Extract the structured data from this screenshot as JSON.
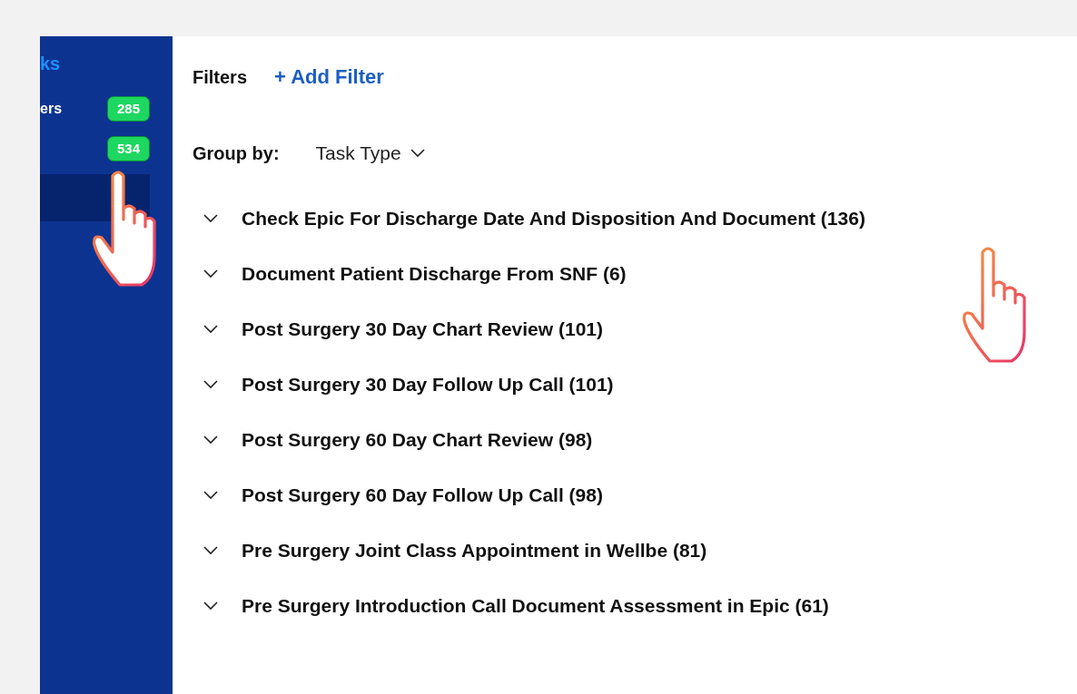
{
  "sidebar": {
    "title": "ks",
    "items": [
      {
        "label": "ers",
        "badge": "285",
        "selected": false
      },
      {
        "badge": "534",
        "selected": false
      },
      {
        "selected": true
      }
    ]
  },
  "filters": {
    "label": "Filters",
    "add_link": "+ Add Filter"
  },
  "group_by": {
    "label": "Group by:",
    "value": "Task Type"
  },
  "groups": [
    {
      "title": "Check Epic For Discharge Date And Disposition And Document (136)",
      "expanded": false
    },
    {
      "title": "Document Patient Discharge From SNF (6)",
      "expanded": false
    },
    {
      "title": "Post Surgery 30 Day Chart Review (101)",
      "expanded": false
    },
    {
      "title": "Post Surgery 30 Day Follow Up Call (101)",
      "expanded": false
    },
    {
      "title": "Post Surgery 60 Day Chart Review (98)",
      "expanded": false
    },
    {
      "title": "Post Surgery 60 Day Follow Up Call (98)",
      "expanded": false
    },
    {
      "title": "Pre Surgery Joint Class Appointment in Wellbe (81)",
      "expanded": false
    },
    {
      "title": "Pre Surgery Introduction Call Document Assessment in Epic (61)",
      "expanded": false
    }
  ]
}
